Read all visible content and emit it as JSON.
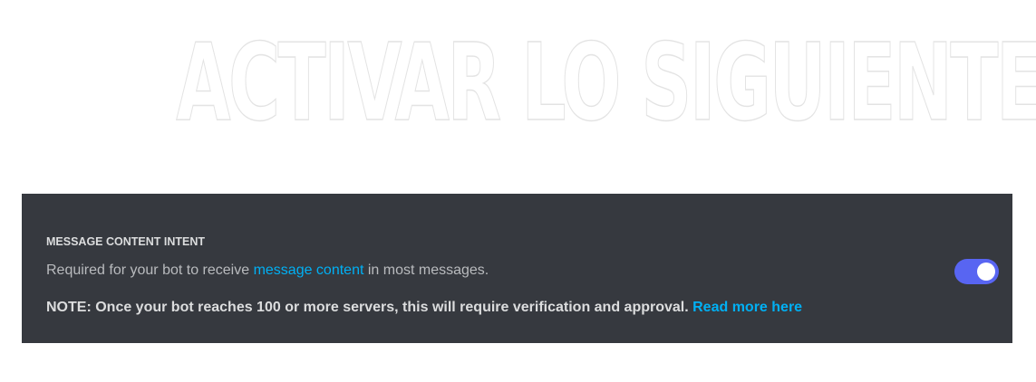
{
  "headline": "ACTIVAR LO SIGUIENTE",
  "intent": {
    "title": "MESSAGE CONTENT INTENT",
    "description_before": "Required for your bot to receive ",
    "description_link": "message content",
    "description_after": " in most messages.",
    "note_text": "NOTE: Once your bot reaches 100 or more servers, this will require verification and approval. ",
    "note_link": "Read more here",
    "toggle_on": true
  },
  "colors": {
    "panel_bg": "#36393f",
    "link": "#00b0f4",
    "toggle_on": "#5865f2"
  }
}
